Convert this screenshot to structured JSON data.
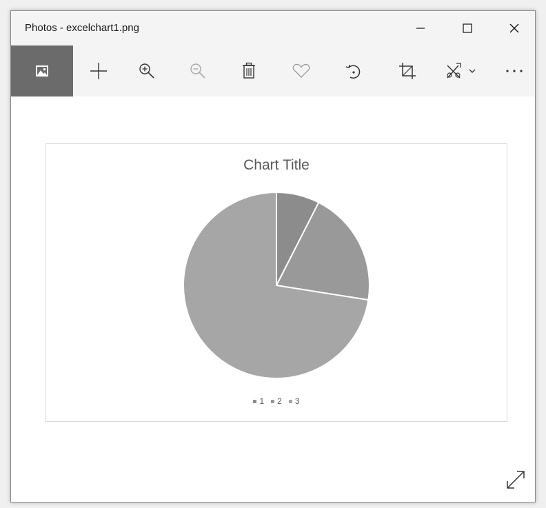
{
  "window": {
    "title": "Photos - excelchart1.png"
  },
  "toolbar": {
    "items": [
      {
        "name": "view-image-icon",
        "active": true
      },
      {
        "name": "add-icon"
      },
      {
        "name": "zoom-in-icon"
      },
      {
        "name": "zoom-out-icon",
        "disabled": true
      },
      {
        "name": "delete-icon"
      },
      {
        "name": "favorite-icon"
      },
      {
        "name": "rotate-icon"
      },
      {
        "name": "crop-icon"
      },
      {
        "name": "edit-create-icon"
      },
      {
        "name": "more-icon"
      }
    ],
    "more_label": "..."
  },
  "chart_data": {
    "type": "pie",
    "title": "Chart Title",
    "categories": [
      "1",
      "2",
      "3"
    ],
    "values": [
      7.5,
      20,
      72.5
    ],
    "colors": [
      "#8c8c8c",
      "#999999",
      "#a6a6a6"
    ],
    "legend": "bottom"
  },
  "colors": {
    "accent_active": "#6b6b6b",
    "toolbar_bg": "#f4f4f4"
  }
}
